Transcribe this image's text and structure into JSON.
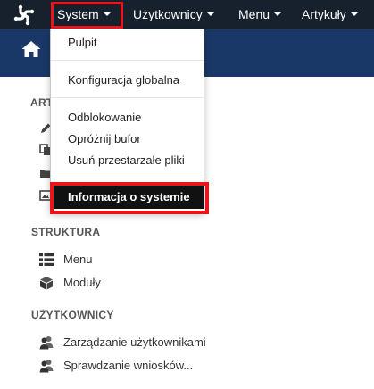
{
  "navbar": {
    "logo_icon": "joomla-logo-icon",
    "items": [
      {
        "label": "System",
        "icon": "caret-down-icon"
      },
      {
        "label": "Użytkownicy",
        "icon": "caret-down-icon"
      },
      {
        "label": "Menu",
        "icon": "caret-down-icon"
      },
      {
        "label": "Artykuły",
        "icon": "caret-down-icon"
      }
    ],
    "background": "#17212d",
    "highlight_color": "#e8151b"
  },
  "header": {
    "icon": "home-icon",
    "background": "#1a3867"
  },
  "system_menu": {
    "items": [
      {
        "label": "Pulpit"
      },
      {
        "label": "Konfiguracja globalna"
      },
      {
        "label": "Odblokowanie"
      },
      {
        "label": "Opróżnij bufor"
      },
      {
        "label": "Usuń przestarzałe pliki"
      },
      {
        "label": "Informacja o systemie",
        "state": "active"
      }
    ]
  },
  "sidebar": {
    "sections": [
      {
        "heading": "ART"
      },
      {
        "heading": "STRUKTURA",
        "items": [
          {
            "label": "Menu",
            "icon": "list-icon"
          },
          {
            "label": "Moduły",
            "icon": "cube-icon"
          }
        ]
      },
      {
        "heading": "UŻYTKOWNICY",
        "items": [
          {
            "label": "Zarządzanie użytkownikami",
            "icon": "users-icon"
          },
          {
            "label": "Sprawdzanie wniosków...",
            "icon": "users-icon"
          }
        ]
      }
    ]
  }
}
